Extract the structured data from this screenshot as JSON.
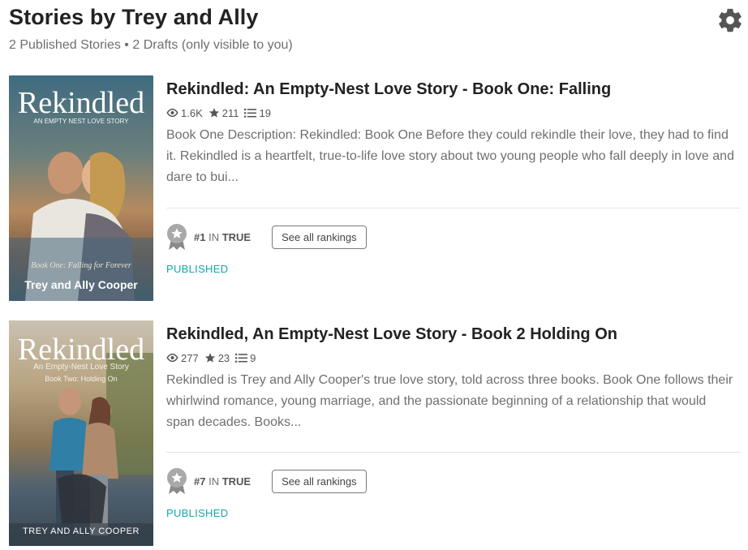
{
  "header": {
    "title": "Stories by Trey and Ally",
    "subtitle": "2 Published Stories • 2 Drafts (only visible to you)",
    "settings_icon": "gear-icon"
  },
  "stories": [
    {
      "title": "Rekindled: An Empty-Nest Love Story - Book One: Falling",
      "reads": "1.6K",
      "votes": "211",
      "parts": "19",
      "description": "Book One Description: Rekindled: Book One Before they could rekindle their love, they had to find it. Rekindled is a heartfelt, true-to-life love story about two young people who fall deeply in love and dare to bui...",
      "rank_number": "#1",
      "rank_in": "IN",
      "rank_tag": "TRUE",
      "rankings_button": "See all rankings",
      "status": "PUBLISHED",
      "cover": {
        "title": "Rekindled",
        "subtitle": "AN EMPTY NEST LOVE STORY",
        "tagline": "Book One: Falling for Forever",
        "author": "Trey and Ally Cooper"
      }
    },
    {
      "title": "Rekindled, An Empty-Nest Love Story - Book 2 Holding On",
      "reads": "277",
      "votes": "23",
      "parts": "9",
      "description": "Rekindled is Trey and Ally Cooper's true love story, told across three books. Book One follows their whirlwind romance, young marriage, and the passionate beginning of a relationship that would span decades. Books...",
      "rank_number": "#7",
      "rank_in": "IN",
      "rank_tag": "TRUE",
      "rankings_button": "See all rankings",
      "status": "PUBLISHED",
      "cover": {
        "title": "Rekindled",
        "subtitle": "An Empty-Nest Love Story",
        "tagline": "Book Two: Holding On",
        "author": "TREY AND ALLY COOPER"
      }
    }
  ],
  "colors": {
    "status": "#12a9a9",
    "title": "#222222",
    "muted": "#6f6f6f"
  }
}
